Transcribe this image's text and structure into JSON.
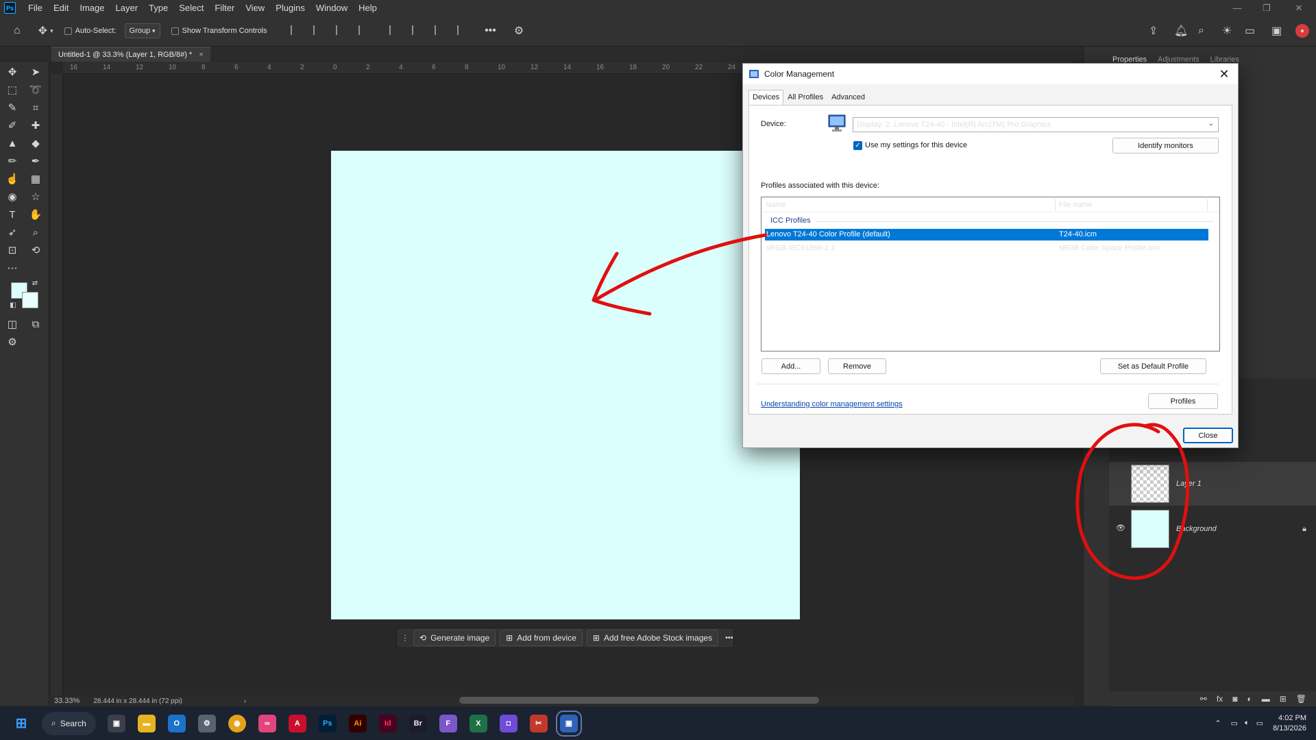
{
  "menubar": {
    "logo": "Ps",
    "items": [
      "File",
      "Edit",
      "Image",
      "Layer",
      "Type",
      "Select",
      "Filter",
      "View",
      "Plugins",
      "Window",
      "Help"
    ]
  },
  "options_bar": {
    "auto_select_label": "Auto-Select:",
    "group_value": "Group",
    "show_transform_label": "Show Transform Controls"
  },
  "document_tab": {
    "title": "Untitled-1 @ 33.3% (Layer 1, RGB/8#) *",
    "close": "×"
  },
  "ruler_ticks": [
    "16",
    "14",
    "12",
    "10",
    "8",
    "6",
    "4",
    "2",
    "0",
    "2",
    "4",
    "6",
    "8",
    "10",
    "12",
    "14",
    "16",
    "18",
    "20",
    "22",
    "24"
  ],
  "contextual_taskbar": {
    "generate_label": "Generate image",
    "add_device_label": "Add from device",
    "stock_label": "Add free Adobe Stock images",
    "more_label": "•••"
  },
  "status_bar": {
    "zoom": "33.33%",
    "doc_size": "28.444 in x 28.444 in (72 ppi)"
  },
  "right_panel": {
    "tabs": [
      "Properties",
      "Adjustments",
      "Libraries"
    ],
    "layers": [
      {
        "name": "Layer 1"
      },
      {
        "name": "Background"
      }
    ]
  },
  "dialog": {
    "title": "Color Management",
    "tabs": [
      "Devices",
      "All Profiles",
      "Advanced"
    ],
    "device_label": "Device:",
    "device_value": "Display: 2. Lenovo T24-40 - Intel(R) Arc(TM) Pro Graphics",
    "use_settings_label": "Use my settings for this device",
    "identify_label": "Identify monitors",
    "profiles_assoc_label": "Profiles associated with this device:",
    "columns": [
      "Name",
      "File name"
    ],
    "group_label": "ICC Profiles",
    "rows": [
      {
        "name": "Lenovo T24-40 Color Profile (default)",
        "file": "T24-40.icm"
      },
      {
        "name": "sRGB IEC61966-2.1",
        "file": "sRGB Color Space Profile.icm"
      }
    ],
    "add_label": "Add...",
    "remove_label": "Remove",
    "set_default_label": "Set as Default Profile",
    "link_label": "Understanding color management settings",
    "profiles_label": "Profiles",
    "close_label": "Close"
  },
  "taskbar": {
    "search_label": "Search",
    "time": "4:02 PM",
    "date": "8/13/2026"
  },
  "colors": {
    "canvas": "#dbfffd",
    "selection": "#0078d7",
    "annotation": "#e01010"
  }
}
